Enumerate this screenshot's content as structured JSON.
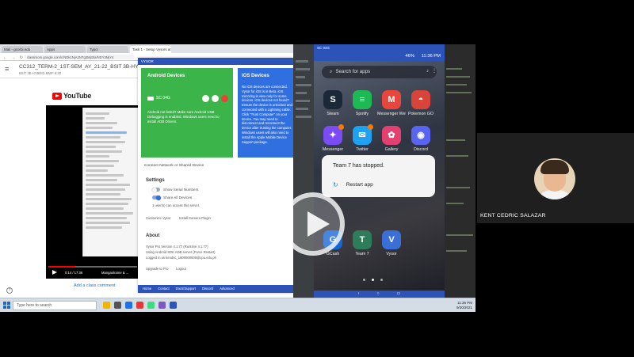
{
  "browser": {
    "tabs": [
      "Mail - gcorbi.edu",
      "Apps",
      "Typcr",
      "Task 1 - Setup Vysors and Laun"
    ],
    "address": "classroom.google.com/c/NDk1NjA2NTg3MjI3/a/NDY3MjY4",
    "page_title": "CC312_TERM-2_1ST-SEM_AY_21-22_BSIT 3B-HYBRID",
    "page_subtitle": "BSIT 3B HYBRID MWF 8:30"
  },
  "youtube": {
    "logo_text": "YouTube",
    "time": "0:14 / 17:36",
    "video_title": "Mangaolrame & ...",
    "comment_link": "Add a class comment"
  },
  "vysor": {
    "window_title": "VYSOR",
    "android": {
      "heading": "Android Devices",
      "device": "SC 04G",
      "note": "Android not listed? Make sure Android USB Debugging is enabled. Windows users need to install ADB Drivers."
    },
    "ios": {
      "heading": "iOS Devices",
      "text": "No iOS devices are connected. Vysor for iOS is in Beta. iOS mirroring is view only for some devices. iOS devices not found? Ensure the device is unlocked and connected with a Lightning cable. Click \"Trust Computer\" on your device. You may need to disconnect and reconnect the device after trusting the computer. Windows users will also need to install the Apple Mobile Device Support package."
    },
    "connect_link": "Connect Network or Shared Device",
    "settings_heading": "Settings",
    "opt_serial": "Show Serial Numbers",
    "opt_share": "Share All Devices",
    "share_note": "1 user(s) can access this server.",
    "account_vysor": "Customize Vysor",
    "account_plugin": "Install Camera Plugin",
    "about_heading": "About",
    "about_lines": [
      "Vysor Pro Version 4.1.77 (Runtime 4.1.77)",
      "Using Android SDK ADB server (Force Restart)",
      "Logged in as kendsc_1800000000@cpu.edu.ph"
    ],
    "upgrade": "Upgrade to Pro",
    "logout": "Logout",
    "footer": [
      "Home",
      "Contact",
      "Docs/Support",
      "Discord",
      "Advanced"
    ]
  },
  "phone": {
    "window_title": "SC 04G",
    "time": "11:36 PM",
    "battery": "46%",
    "search_placeholder": "Search for apps",
    "apps": [
      {
        "label": "Steam",
        "color": "#1b2838",
        "glyph": "S",
        "badge": false
      },
      {
        "label": "Spotify",
        "color": "#1db954",
        "glyph": "≡",
        "badge": false
      },
      {
        "label": "Messenger Webster Di...",
        "color": "#e8453c",
        "glyph": "M",
        "badge": false
      },
      {
        "label": "Pokemon GO",
        "color": "#d9443a",
        "glyph": "◓",
        "badge": false
      },
      {
        "label": "Messenger",
        "color": "#7b4cf3",
        "glyph": "✦",
        "badge": true
      },
      {
        "label": "Twitter",
        "color": "#1da1f2",
        "glyph": "✉",
        "badge": true
      },
      {
        "label": "Gallery",
        "color": "#e4406f",
        "glyph": "✿",
        "badge": false
      },
      {
        "label": "Discord",
        "color": "#5865f2",
        "glyph": "◉",
        "badge": false
      },
      {
        "label": "GCash",
        "color": "#1565d8",
        "glyph": "G",
        "badge": false
      },
      {
        "label": "Team 7",
        "color": "#2e7d5a",
        "glyph": "T",
        "badge": false
      },
      {
        "label": "Vysor",
        "color": "#3b6fd8",
        "glyph": "V",
        "badge": false
      }
    ],
    "dialog_title": "Team 7 has stopped.",
    "dialog_action": "Restart app",
    "nav": [
      "‹",
      "○",
      "▭"
    ]
  },
  "taskbar": {
    "search_placeholder": "Type here to search",
    "time": "11:36 PM",
    "date": "9/30/2021"
  },
  "participant": {
    "name": "KENT CEDRIC SALAZAR"
  }
}
